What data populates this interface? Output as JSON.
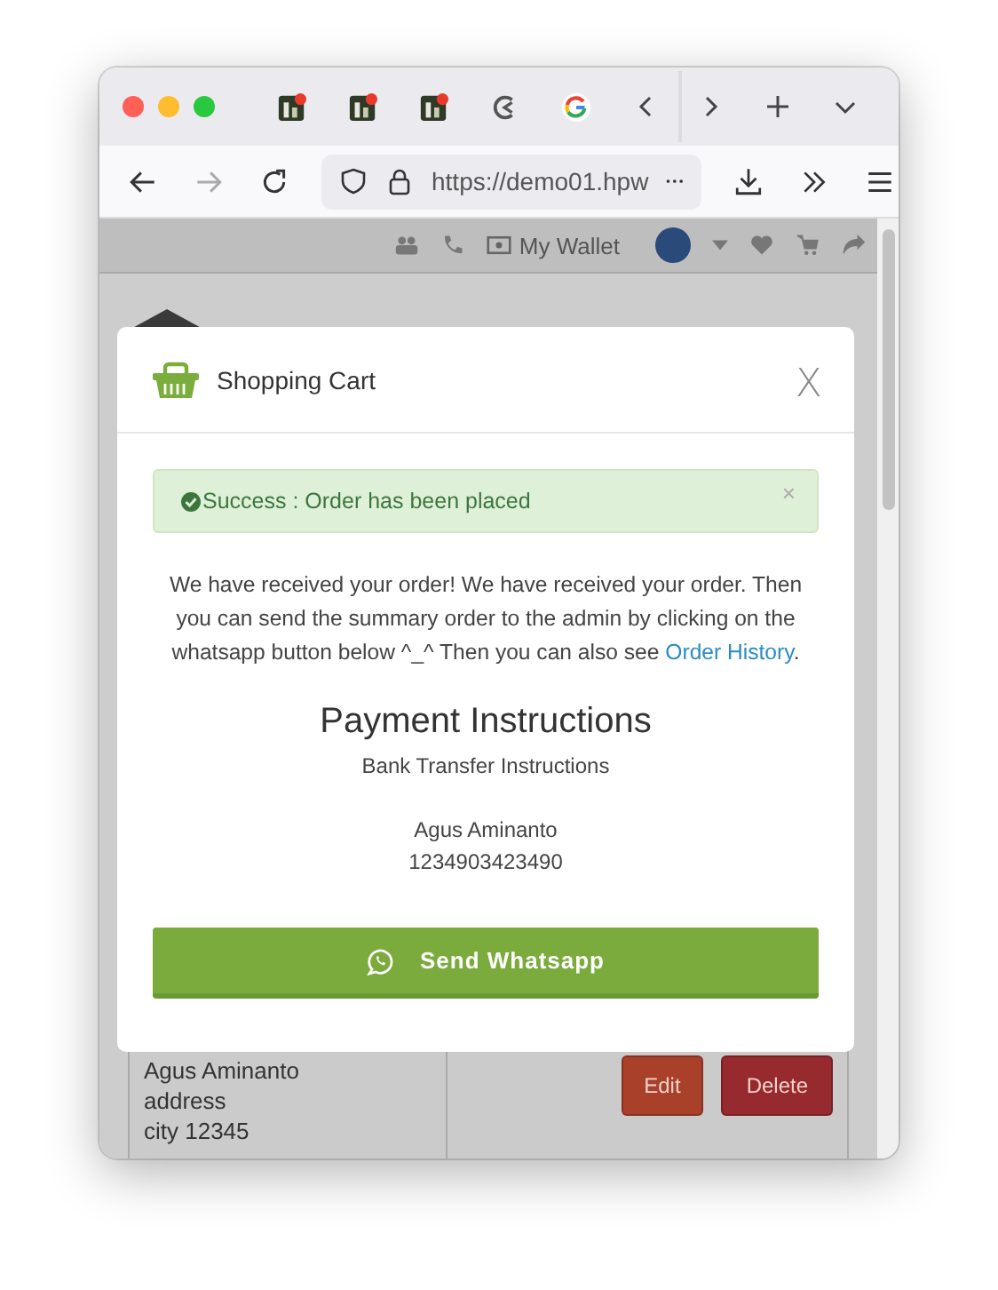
{
  "browser": {
    "url": "https://demo01.hpw"
  },
  "site_header": {
    "wallet": "My Wallet"
  },
  "modal": {
    "title": "Shopping Cart",
    "close": "X",
    "alert": {
      "text": "Success : Order has been placed",
      "close": "×"
    },
    "message": {
      "text": "We have received your order! We have received your order. Then you can send the summary order to the admin by clicking on the whatsapp button below ^_^ Then you can also see ",
      "link": "Order History",
      "end": "."
    },
    "heading": "Payment Instructions",
    "subheading": "Bank Transfer Instructions",
    "account_name": "Agus Aminanto",
    "account_number": "1234903423490",
    "button": "Send Whatsapp"
  },
  "background": {
    "address_lines": [
      "Agus Aminanto",
      "address",
      "city 12345"
    ],
    "buttons": [
      {
        "label": "Edit",
        "kind": "edit"
      },
      {
        "label": "Delete",
        "kind": "delete"
      }
    ]
  }
}
